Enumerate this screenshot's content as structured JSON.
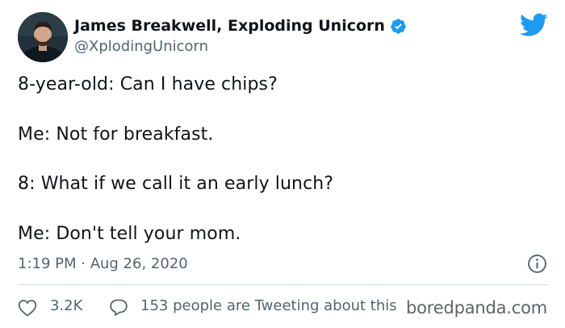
{
  "author": {
    "display_name": "James Breakwell, Exploding Unicorn",
    "handle": "@XplodingUnicorn",
    "verified": true,
    "avatar_icon": "profile-photo"
  },
  "tweet": {
    "lines": [
      "8-year-old: Can I have chips?",
      "Me: Not for breakfast.",
      "8: What if we call it an early lunch?",
      "Me: Don't tell your mom."
    ],
    "timestamp": "1:19 PM · Aug 26, 2020"
  },
  "actions": {
    "like_count": "3.2K",
    "conversation_text": "153 people are Tweeting about this"
  },
  "watermark": "boredpanda.com",
  "icons": {
    "brand": "twitter-bird-icon",
    "verified": "verified-badge-icon",
    "info": "info-icon",
    "like": "heart-icon",
    "reply": "speech-bubble-icon"
  },
  "colors": {
    "twitter_blue": "#1d9bf0",
    "text_primary": "#0f1419",
    "text_secondary": "#536471",
    "divider": "#cfd9de"
  }
}
